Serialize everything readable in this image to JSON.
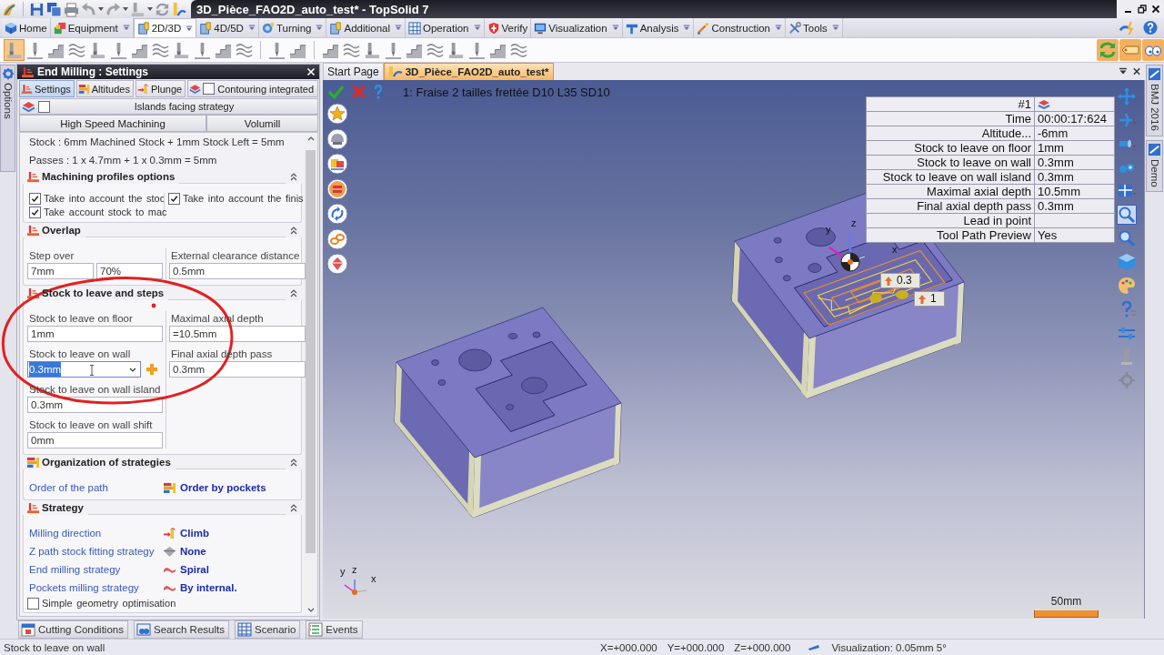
{
  "title_bar": {
    "title": "3D_Pièce_FAO2D_auto_test* - TopSolid 7"
  },
  "ribbon": {
    "tabs": [
      {
        "label": "Home",
        "selected": false,
        "menu": false
      },
      {
        "label": "Equipment",
        "selected": false,
        "menu": true
      },
      {
        "label": "2D/3D",
        "selected": true,
        "menu": true
      },
      {
        "label": "4D/5D",
        "selected": false,
        "menu": true
      },
      {
        "label": "Turning",
        "selected": false,
        "menu": true
      },
      {
        "label": "Additional",
        "selected": false,
        "menu": true
      },
      {
        "label": "Operation",
        "selected": false,
        "menu": true
      },
      {
        "label": "Verify",
        "selected": false,
        "menu": false
      },
      {
        "label": "Visualization",
        "selected": false,
        "menu": true
      },
      {
        "label": "Analysis",
        "selected": false,
        "menu": true
      },
      {
        "label": "Construction",
        "selected": false,
        "menu": true
      },
      {
        "label": "Tools",
        "selected": false,
        "menu": true
      }
    ],
    "tool_groups": [
      [
        {
          "selected": true
        },
        {
          "selected": false
        },
        {
          "selected": false
        },
        {
          "selected": false
        },
        {
          "selected": false
        },
        {
          "selected": false
        },
        {
          "selected": false
        },
        {
          "selected": false
        },
        {
          "selected": false
        },
        {
          "selected": false
        },
        {
          "selected": false
        },
        {
          "selected": false
        }
      ],
      [
        {
          "selected": false
        },
        {
          "selected": false
        }
      ],
      [
        {
          "selected": false
        },
        {
          "selected": false
        },
        {
          "selected": false
        },
        {
          "selected": false
        },
        {
          "selected": false
        },
        {
          "selected": false
        },
        {
          "selected": false
        },
        {
          "selected": false
        },
        {
          "selected": false
        },
        {
          "selected": false
        }
      ]
    ]
  },
  "options_tab": {
    "label": "Options"
  },
  "panel": {
    "title": "End Milling : Settings",
    "tabs": [
      {
        "label": "Settings",
        "kind": "tab",
        "selected": true
      },
      {
        "label": "Altitudes",
        "kind": "tab",
        "selected": false
      },
      {
        "label": "Plunge",
        "kind": "tab",
        "selected": false
      },
      {
        "label": "Contouring integrated",
        "kind": "toggle",
        "checked": false
      }
    ],
    "toggles": [
      {
        "label": "Islands facing strategy",
        "checked": false
      }
    ],
    "sub_tabs": [
      {
        "label": "High Speed Machining"
      },
      {
        "label": "Volumill"
      }
    ],
    "summary": [
      "Stock : 6mm Machined Stock + 1mm Stock Left = 5mm",
      "Passes : 1 x 4.7mm + 1 x 0.3mm = 5mm"
    ],
    "groups": [
      {
        "kind": "checks",
        "title": "Machining profiles options",
        "expanded": true,
        "items": [
          {
            "label": "Take into account the stoc",
            "checked": true
          },
          {
            "label": "Take into account the finis",
            "checked": true
          },
          {
            "label": "Take account stock to mac",
            "checked": true
          }
        ]
      },
      {
        "kind": "fields",
        "title": "Overlap",
        "expanded": true,
        "columns": [
          [
            {
              "label": "Step over",
              "kind": "text",
              "highlighted": false,
              "values": [
                "7mm",
                "70%"
              ]
            }
          ],
          [
            {
              "label": "External clearance distance",
              "kind": "text",
              "highlighted": false,
              "values": [
                "0.5mm"
              ]
            }
          ]
        ]
      },
      {
        "kind": "fields",
        "title": "Stock to leave and steps",
        "expanded": true,
        "columns": [
          [
            {
              "label": "Stock to leave on floor",
              "kind": "text",
              "highlighted": false,
              "values": [
                "1mm"
              ]
            },
            {
              "label": "Stock to leave on wall",
              "kind": "combo",
              "highlighted": true,
              "values": [
                "0.3mm"
              ]
            },
            {
              "label": "Stock to leave on wall island",
              "kind": "text",
              "highlighted": false,
              "values": [
                "0.3mm"
              ]
            },
            {
              "label": "Stock to leave on wall shift",
              "kind": "text",
              "highlighted": false,
              "values": [
                "0mm"
              ]
            }
          ],
          [
            {
              "label": "Maximal axial depth",
              "kind": "text",
              "highlighted": false,
              "values": [
                "=10.5mm"
              ]
            },
            {
              "label": "Final axial depth pass",
              "kind": "text",
              "highlighted": false,
              "values": [
                "0.3mm"
              ]
            }
          ]
        ]
      },
      {
        "kind": "options",
        "title": "Organization of strategies",
        "expanded": true,
        "items": [
          {
            "kind": "option",
            "label": "Order of the path",
            "value": "Order by pockets"
          }
        ]
      },
      {
        "kind": "options",
        "title": "Strategy",
        "expanded": true,
        "items": [
          {
            "kind": "option",
            "label": "Milling direction",
            "value": "Climb"
          },
          {
            "kind": "option",
            "label": "Z path stock fitting strategy",
            "value": "None"
          },
          {
            "kind": "option",
            "label": "End milling strategy",
            "value": "Spiral"
          },
          {
            "kind": "option",
            "label": "Pockets milling strategy",
            "value": "By internal."
          },
          {
            "kind": "checkbox",
            "label": "Simple geometry optimisation",
            "checked": false
          }
        ]
      }
    ]
  },
  "document_tabs": [
    {
      "label": "Start Page",
      "selected": false
    },
    {
      "label": "3D_Pièce_FAO2D_auto_test*",
      "selected": true
    }
  ],
  "viewport": {
    "operation": "1: Fraise 2 tailles frettée D10 L35 SD10",
    "info_table": {
      "header": "#1",
      "rows": [
        {
          "label": "Time",
          "value": "00:00:17:624"
        },
        {
          "label": "Altitude...",
          "value": "-6mm"
        },
        {
          "label": "Stock to leave on floor",
          "value": "1mm"
        },
        {
          "label": "Stock to leave on wall",
          "value": "0.3mm"
        },
        {
          "label": "Stock to leave on wall island",
          "value": "0.3mm"
        },
        {
          "label": "Maximal axial depth",
          "value": "10.5mm"
        },
        {
          "label": "Final axial depth pass",
          "value": "0.3mm"
        },
        {
          "label": "Lead in point"
        },
        {
          "label": "Tool Path Preview",
          "value": "Yes"
        }
      ]
    },
    "callouts": [
      "0.3",
      "1"
    ],
    "part_axes": [
      "y",
      "z",
      "x"
    ],
    "triad_axes": [
      "y",
      "z",
      "x"
    ],
    "scale": "50mm",
    "view_tools": [
      {
        "selected": false
      },
      {
        "selected": false
      },
      {
        "selected": false
      },
      {
        "selected": false
      },
      {
        "selected": false
      },
      {
        "selected": true
      },
      {
        "selected": false
      },
      {
        "selected": false
      },
      {
        "selected": false
      },
      {
        "selected": false
      },
      {
        "selected": false
      },
      {
        "selected": false
      },
      {
        "selected": false
      }
    ]
  },
  "side_tabs": [
    {
      "label": "BMJ 2016"
    },
    {
      "label": "Demo"
    }
  ],
  "bottom_tabs": [
    {
      "label": "Cutting Conditions"
    },
    {
      "label": "Search Results"
    },
    {
      "label": "Scenario"
    },
    {
      "label": "Events"
    }
  ],
  "status_bar": {
    "message": "Stock to leave on wall",
    "coordinates": [
      "X=+000.000",
      "Y=+000.000",
      "Z=+000.000"
    ],
    "visualization": "Visualization: 0.05mm 5°"
  }
}
